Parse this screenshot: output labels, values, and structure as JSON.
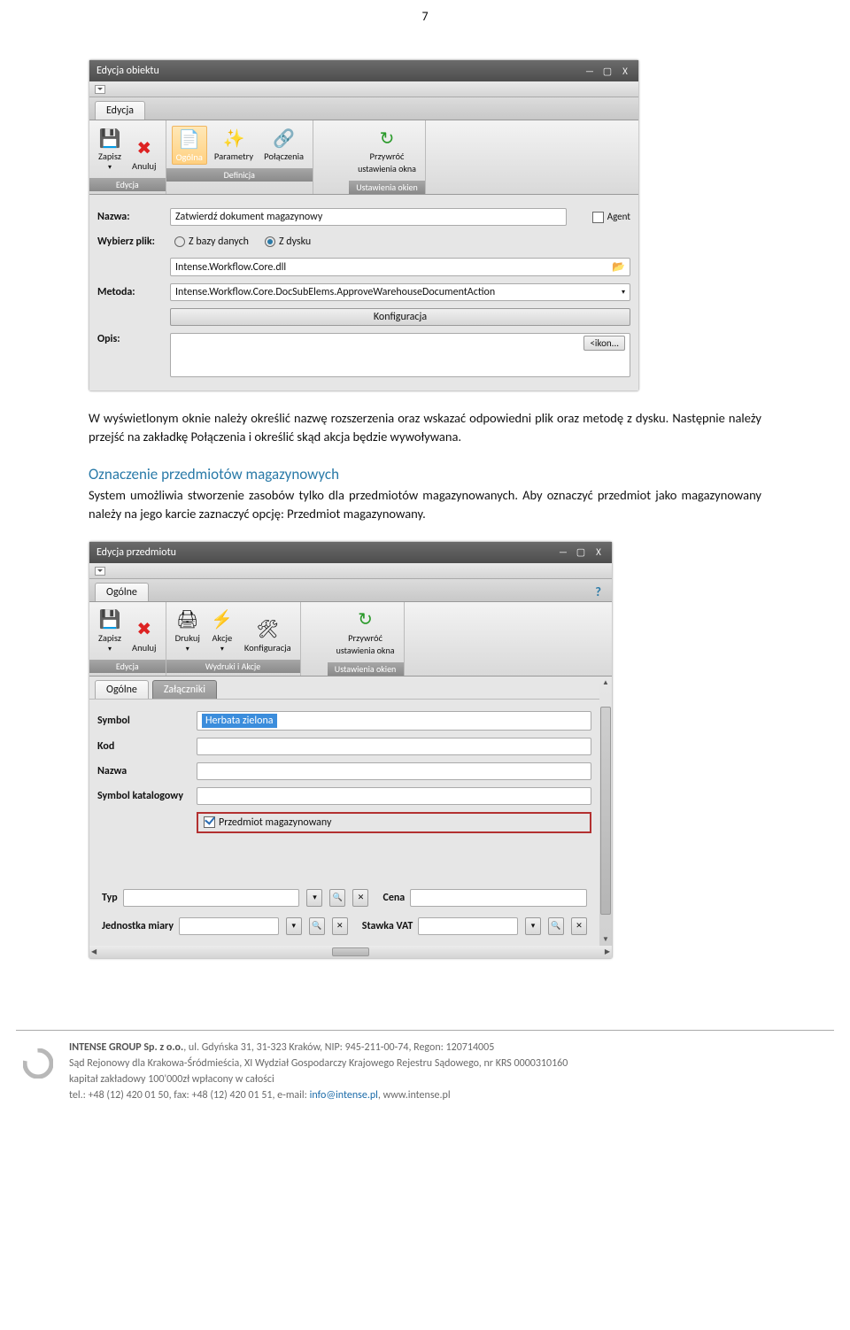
{
  "page_number": "7",
  "para1": "W wyświetlonym oknie należy określić nazwę rozszerzenia oraz wskazać odpowiedni plik oraz metodę z dysku. Następnie należy przejść na zakładkę Połączenia i określić skąd akcja będzie wywoływana.",
  "section_title": "Oznaczenie przedmiotów magazynowych",
  "para2": "System umożliwia stworzenie zasobów tylko dla przedmiotów magazynowanych. Aby oznaczyć przedmiot jako magazynowany należy na jego karcie zaznaczyć opcję: Przedmiot magazynowany.",
  "shot1": {
    "title": "Edycja obiektu",
    "tab": "Edycja",
    "ribbon": {
      "g1": {
        "cap": "Edycja",
        "items": [
          {
            "l": "Zapisz",
            "i": "💾"
          },
          {
            "l": "Anuluj",
            "i": "✖"
          }
        ]
      },
      "g2": {
        "cap": "Definicja",
        "items": [
          {
            "l": "Ogólna",
            "i": "📝",
            "sel": true
          },
          {
            "l": "Parametry",
            "i": "✨"
          },
          {
            "l": "Połączenia",
            "i": "🔗"
          }
        ]
      },
      "g3": {
        "cap": "Ustawienia okien",
        "items": [
          {
            "l": "Przywróć",
            "l2": "ustawienia okna",
            "i": "↻"
          }
        ]
      }
    },
    "form": {
      "nazwa_l": "Nazwa:",
      "nazwa_v": "Zatwierdź dokument magazynowy",
      "agent_l": "Agent",
      "wybierz_l": "Wybierz plik:",
      "opt1": "Z bazy danych",
      "opt2": "Z dysku",
      "file_v": "Intense.Workflow.Core.dll",
      "metoda_l": "Metoda:",
      "metoda_v": "Intense.Workflow.Core.DocSubElems.ApproveWarehouseDocumentAction",
      "konf": "Konfiguracja",
      "opis_l": "Opis:",
      "ikon_btn": "<ikon..."
    }
  },
  "shot2": {
    "title": "Edycja przedmiotu",
    "tab1": "Ogólne",
    "ribbon": {
      "g1": {
        "cap": "Edycja",
        "items": [
          {
            "l": "Zapisz",
            "i": "💾"
          },
          {
            "l": "Anuluj",
            "i": "✖"
          }
        ]
      },
      "g2": {
        "cap": "Wydruki i Akcje",
        "items": [
          {
            "l": "Drukuj",
            "i": "🖨"
          },
          {
            "l": "Akcje",
            "i": "⚡"
          },
          {
            "l": "Konfiguracja",
            "i": "🛠"
          }
        ]
      },
      "g3": {
        "cap": "Ustawienia okien",
        "items": [
          {
            "l": "Przywróć",
            "l2": "ustawienia okna",
            "i": "↻"
          }
        ]
      }
    },
    "subtabs": [
      "Ogólne",
      "Załączniki"
    ],
    "fields": {
      "symbol_l": "Symbol",
      "symbol_v": "Herbata zielona",
      "kod_l": "Kod",
      "nazwa_l": "Nazwa",
      "kat_l": "Symbol katalogowy",
      "chk": "Przedmiot magazynowany",
      "typ_l": "Typ",
      "cena_l": "Cena",
      "jm_l": "Jednostka miary",
      "vat_l": "Stawka VAT"
    }
  },
  "footer": {
    "l1a": "INTENSE GROUP  Sp. z o.o.",
    "l1b": ", ul. Gdyńska 31, 31-323 Kraków, NIP: 945-211-00-74, Regon: 120714005",
    "l2": "Sąd Rejonowy dla Krakowa-Śródmieścia, XI Wydział Gospodarczy Krajowego Rejestru Sądowego, nr KRS 0000310160",
    "l3": "kapitał zakładowy 100'000zł wpłacony w całości",
    "l4a": "tel.: +48 (12) 420 01 50, fax: +48 (12) 420 01 51, e-mail: ",
    "l4b": "info@intense.pl",
    "l4c": ", www.intense.pl"
  }
}
